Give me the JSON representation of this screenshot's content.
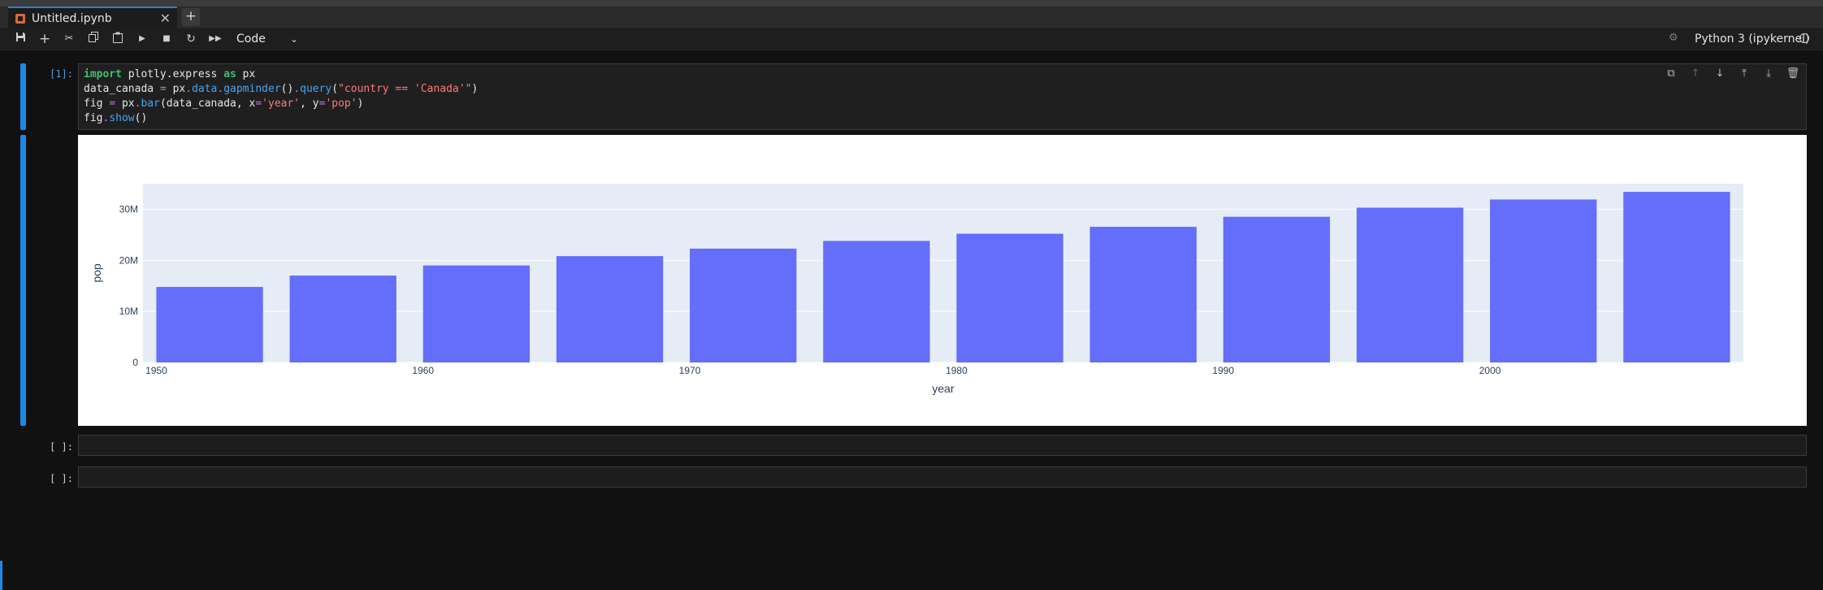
{
  "tab": {
    "title": "Untitled.ipynb",
    "close": "✕",
    "add": "+"
  },
  "toolbar": {
    "cell_type": "Code",
    "kernel_name": "Python 3 (ipykernel)",
    "icons": [
      "save-icon",
      "add-icon",
      "cut-icon",
      "copy-icon",
      "paste-icon",
      "run-icon",
      "stop-icon",
      "restart-icon",
      "fast-forward-icon"
    ]
  },
  "cell1": {
    "prompt": "[1]:",
    "code": [
      "import plotly.express as px",
      "data_canada = px.data.gapminder().query(\"country == 'Canada'\")",
      "fig = px.bar(data_canada, x='year', y='pop')",
      "fig.show()"
    ]
  },
  "cells_empty": [
    {
      "prompt": "[ ]:"
    },
    {
      "prompt": "[ ]:"
    }
  ],
  "colors": {
    "accent": "#1e88e5",
    "bar": "#636efa",
    "plot_bg": "#e5ecf6"
  },
  "chart_data": {
    "type": "bar",
    "x": [
      1952,
      1957,
      1962,
      1967,
      1972,
      1977,
      1982,
      1987,
      1992,
      1997,
      2002,
      2007
    ],
    "values": [
      14785584,
      17010154,
      18985849,
      20819767,
      22284500,
      23796400,
      25201900,
      26549700,
      28523502,
      30305843,
      31902268,
      33390141
    ],
    "xlabel": "year",
    "ylabel": "pop",
    "xticks": [
      1950,
      1960,
      1970,
      1980,
      1990,
      2000
    ],
    "yticks": [
      {
        "value": 0,
        "label": "0"
      },
      {
        "value": 10000000,
        "label": "10M"
      },
      {
        "value": 20000000,
        "label": "20M"
      },
      {
        "value": 30000000,
        "label": "30M"
      }
    ],
    "xlim": [
      1949.5,
      2009.5
    ],
    "ylim": [
      0,
      35000000
    ],
    "grid": true
  }
}
